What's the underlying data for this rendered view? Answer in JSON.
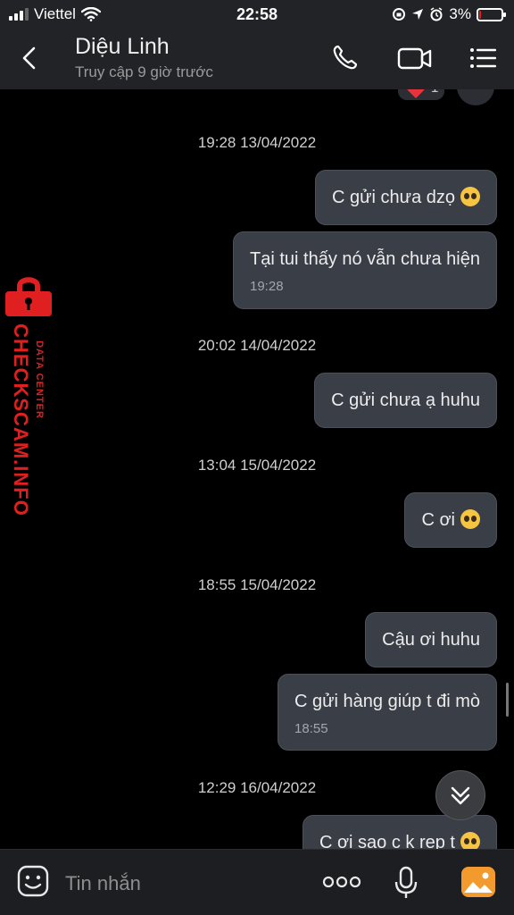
{
  "status_bar": {
    "carrier": "Viettel",
    "time": "22:58",
    "battery_text": "3%",
    "battery_level": 0.03
  },
  "header": {
    "contact_name": "Diệu Linh",
    "contact_status": "Truy cập 9 giờ trước",
    "icons": [
      "back-icon",
      "phone-icon",
      "video-call-icon",
      "menu-icon"
    ]
  },
  "messages": [
    {
      "type": "time",
      "text": "19:28 13/04/2022"
    },
    {
      "type": "bubble",
      "text": "C gửi chưa dzọ",
      "emoji": "pleading-face"
    },
    {
      "type": "bubble",
      "text": "Tại tui thấy nó vẫn chưa hiện",
      "time": "19:28"
    },
    {
      "type": "time",
      "text": "20:02 14/04/2022"
    },
    {
      "type": "bubble",
      "text": "C gửi chưa ạ huhu"
    },
    {
      "type": "time",
      "text": "13:04 15/04/2022"
    },
    {
      "type": "bubble",
      "text": "C ơi",
      "emoji": "pleading-face"
    },
    {
      "type": "time",
      "text": "18:55 15/04/2022"
    },
    {
      "type": "bubble",
      "text": "Cậu ơi huhu"
    },
    {
      "type": "bubble",
      "text": "C gửi hàng giúp t đi mò",
      "time": "18:55"
    },
    {
      "type": "time",
      "text": "12:29 16/04/2022"
    },
    {
      "type": "bubble",
      "text": "C ơi sao c k rep t",
      "emoji": "disappointed-face"
    }
  ],
  "reaction": {
    "count": "1",
    "icon": "heart-icon"
  },
  "watermark": {
    "brand": "CHECKSCAM.INFO",
    "sub": "DATA CENTER"
  },
  "input_bar": {
    "placeholder": "Tin nhắn",
    "icons": [
      "sticker-icon",
      "more-icon",
      "mic-icon",
      "photo-icon"
    ]
  },
  "colors": {
    "background": "#000000",
    "bubble": "#3a3e47",
    "header": "#222326",
    "accent_orange": "#f29a2e",
    "watermark_red": "#e02020"
  }
}
